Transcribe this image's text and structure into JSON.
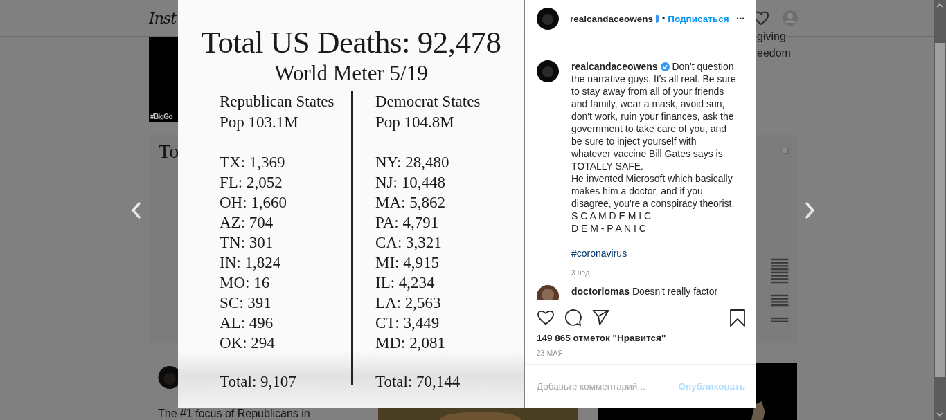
{
  "background_page": {
    "logo": "Inst",
    "post_text": [
      "giving",
      "eedom"
    ],
    "image_caption": "#BigGo",
    "card": {
      "title": "To"
    },
    "post_snippet": "The #1 focus of Republicans in"
  },
  "post_image": {
    "title": "Total US Deaths: 92,478",
    "subtitle": "World Meter 5/19",
    "columns": [
      {
        "heading": "Republican States",
        "population": "Pop 103.1M",
        "rows": [
          "TX: 1,369",
          "FL: 2,052",
          "OH: 1,660",
          "AZ: 704",
          "TN: 301",
          "IN: 1,824",
          "MO: 16",
          "SC: 391",
          "AL: 496",
          "OK: 294"
        ],
        "total": "Total: 9,107"
      },
      {
        "heading": "Democrat States",
        "population": "Pop 104.8M",
        "rows": [
          "NY: 28,480",
          "NJ: 10,448",
          "MA: 5,862",
          "PA: 4,791",
          "CA: 3,321",
          "MI: 4,915",
          "IL: 4,234",
          "LA: 2,563",
          "CT: 3,449",
          "MD: 2,081"
        ],
        "total": "Total: 70,144"
      }
    ]
  },
  "header": {
    "username": "realcandaceowens",
    "verified": true,
    "separator": "•",
    "follow": "Подписаться",
    "more": "•••"
  },
  "caption": {
    "username": "realcandaceowens",
    "verified": true,
    "text": "Don't question the narrative guys. It's all real. Be sure to stay away from all of your friends and family, wear a mask, avoid sun, don't work, ruin your finances, ask the government to take care of you, and be sure to inject yourself with whatever vaccine Bill Gates says is TOTALLY SAFE.",
    "lines": [
      "He invented Microsoft which basically makes him a doctor, and if you disagree, you're a conspiracy theorist.",
      "S C A M D E M I C",
      "D E M - P A N I C"
    ],
    "hashtag": "#coronavirus",
    "age": "3 нед."
  },
  "comment": {
    "username": "doctorlomas",
    "text": "Doesn't really factor"
  },
  "likes": "149 865 отметок \"Нравится\"",
  "date": "23 МАЯ",
  "comment_box": {
    "placeholder": "Добавьте комментарий...",
    "post_button": "Опубликовать"
  }
}
